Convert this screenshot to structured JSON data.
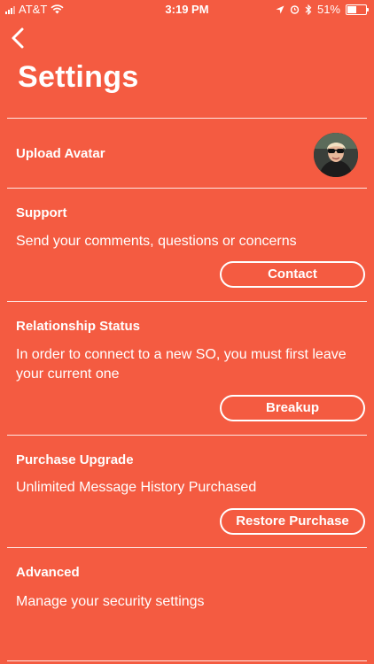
{
  "status_bar": {
    "carrier": "AT&T",
    "time": "3:19 PM",
    "battery_percent": "51%",
    "battery_level": 0.51
  },
  "header": {
    "title": "Settings"
  },
  "sections": {
    "avatar": {
      "label": "Upload Avatar"
    },
    "support": {
      "label": "Support",
      "text": "Send your comments, questions or concerns",
      "button": "Contact"
    },
    "relationship": {
      "label": "Relationship Status",
      "text": "In order to connect to a new SO, you must first leave your current one",
      "button": "Breakup"
    },
    "purchase": {
      "label": "Purchase Upgrade",
      "text": "Unlimited Message History Purchased",
      "button": "Restore Purchase"
    },
    "advanced": {
      "label": "Advanced",
      "text": "Manage your security settings"
    }
  },
  "colors": {
    "background": "#F45B41",
    "foreground": "#FFFFFF"
  },
  "icons": {
    "back": "chevron-left-icon",
    "signal": "signal-icon",
    "wifi": "wifi-icon",
    "location": "location-icon",
    "alarm": "alarm-icon",
    "bluetooth": "bluetooth-icon",
    "battery": "battery-icon"
  }
}
